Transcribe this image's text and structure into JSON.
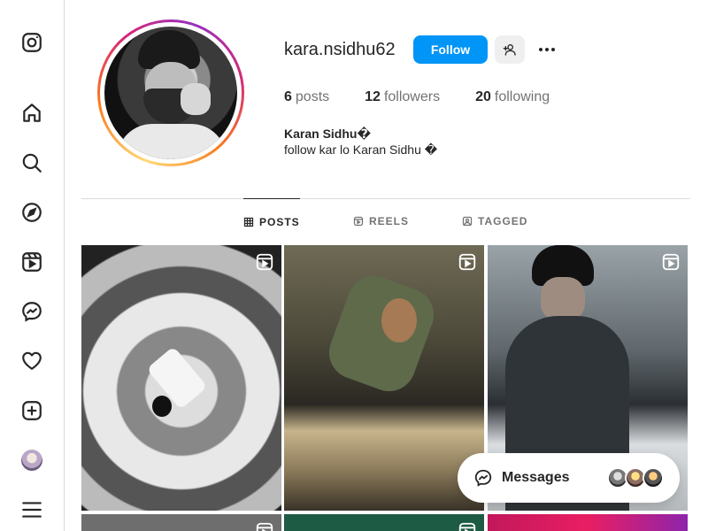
{
  "sidebar": {
    "items": [
      {
        "name": "instagram-logo-icon"
      },
      {
        "name": "home-icon"
      },
      {
        "name": "search-icon"
      },
      {
        "name": "explore-icon"
      },
      {
        "name": "reels-icon"
      },
      {
        "name": "messenger-icon"
      },
      {
        "name": "notifications-heart-icon"
      },
      {
        "name": "create-icon"
      },
      {
        "name": "profile-avatar"
      },
      {
        "name": "more-menu-icon"
      }
    ]
  },
  "profile": {
    "username": "kara.nsidhu62",
    "follow_label": "Follow",
    "stats": {
      "posts_count": "6",
      "posts_label": "posts",
      "followers_count": "12",
      "followers_label": "followers",
      "following_count": "20",
      "following_label": "following"
    },
    "full_name": "Karan Sidhu�",
    "bio": "follow kar lo Karan Sidhu �"
  },
  "tabs": [
    {
      "label": "POSTS",
      "active": true
    },
    {
      "label": "REELS",
      "active": false
    },
    {
      "label": "TAGGED",
      "active": false
    }
  ],
  "posts": [
    {
      "type": "reel"
    },
    {
      "type": "reel"
    },
    {
      "type": "reel"
    },
    {
      "type": "reel"
    },
    {
      "type": "reel"
    },
    {
      "type": "post"
    }
  ],
  "messages": {
    "label": "Messages"
  },
  "colors": {
    "accent": "#0095f6",
    "text": "#262626",
    "muted": "#737373",
    "border": "#dbdbdb"
  }
}
